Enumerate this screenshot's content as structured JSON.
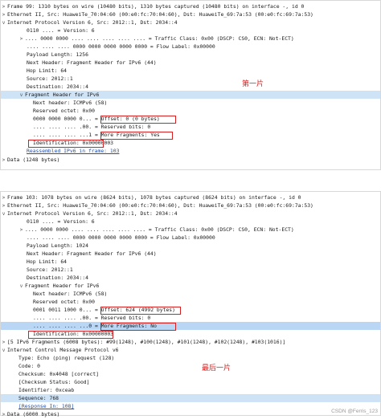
{
  "top": {
    "frame": "Frame 99: 1310 bytes on wire (10480 bits), 1310 bytes captured (10480 bits) on interface -, id 0",
    "eth": "Ethernet II, Src: HuaweiTe_70:04:60 (00:e0:fc:70:04:60), Dst: HuaweiTe_69:7a:53 (00:e0:fc:69:7a:53)",
    "ipv6": "Internet Protocol Version 6, Src: 2012::1, Dst: 2034::4",
    "version": "0110 .... = Version: 6",
    "traffic": ".... 0000 0000 .... .... .... .... .... = Traffic Class: 0x00 (DSCP: CS0, ECN: Not-ECT)",
    "flow": ".... .... .... 0000 0000 0000 0000 0000 = Flow Label: 0x00000",
    "payload": "Payload Length: 1256",
    "next_header": "Next Header: Fragment Header for IPv6 (44)",
    "hop": "Hop Limit: 64",
    "source": "Source: 2012::1",
    "dest": "Destination: 2034::4",
    "frag_header": "Fragment Header for IPv6",
    "frag_next": "Next header: ICMPv6 (58)",
    "reserved_octet": "Reserved octet: 0x00",
    "offset_bits": "0000 0000 0000 0... = ",
    "offset": "Offset: 0 (0 bytes)",
    "reserved_bits": ".... .... .... .00. = Reserved bits: 0",
    "more_bits": ".... .... .... ...1 = ",
    "more": "More Fragments: Yes",
    "identification": "Identification: 0x00000003",
    "reassembled": "Reassembled IPv6 in frame: 103",
    "data": "Data (1248 bytes)",
    "annotation": "第一片"
  },
  "bottom": {
    "frame": "Frame 103: 1078 bytes on wire (8624 bits), 1078 bytes captured (8624 bits) on interface -, id 0",
    "eth": "Ethernet II, Src: HuaweiTe_70:04:60 (00:e0:fc:70:04:60), Dst: HuaweiTe_69:7a:53 (00:e0:fc:69:7a:53)",
    "ipv6": "Internet Protocol Version 6, Src: 2012::1, Dst: 2034::4",
    "version": "0110 .... = Version: 6",
    "traffic": ".... 0000 0000 .... .... .... .... .... = Traffic Class: 0x00 (DSCP: CS0, ECN: Not-ECT)",
    "flow": ".... .... .... 0000 0000 0000 0000 0000 = Flow Label: 0x00000",
    "payload": "Payload Length: 1024",
    "next_header": "Next Header: Fragment Header for IPv6 (44)",
    "hop": "Hop Limit: 64",
    "source": "Source: 2012::1",
    "dest": "Destination: 2034::4",
    "frag_header": "Fragment Header for IPv6",
    "frag_next": "Next header: ICMPv6 (58)",
    "reserved_octet": "Reserved octet: 0x00",
    "offset_bits": "0001 0011 1000 0... = ",
    "offset": "Offset: 624 (4992 bytes)",
    "reserved_bits": ".... .... .... .00. = Reserved bits: 0",
    "more_bits": ".... .... .... ...0 = ",
    "more": "More Fragments: No",
    "identification": "Identification: 0x00000003",
    "fragments": "[5 IPv6 Fragments (6008 bytes): #99(1248), #100(1248), #101(1248), #102(1248), #103(1016)]",
    "icmp": "Internet Control Message Protocol v6",
    "type": "Type: Echo (ping) request (128)",
    "code": "Code: 0",
    "checksum": "Checksum: 0x4048 [correct]",
    "checksum_status": "[Checksum Status: Good]",
    "identifier": "Identifier: 0xceab",
    "sequence": "Sequence: 768",
    "response": "[Response In: 108]",
    "data": "Data (6000 bytes)",
    "annotation": "最后一片"
  },
  "watermark": "CSDN @Ferris_123"
}
